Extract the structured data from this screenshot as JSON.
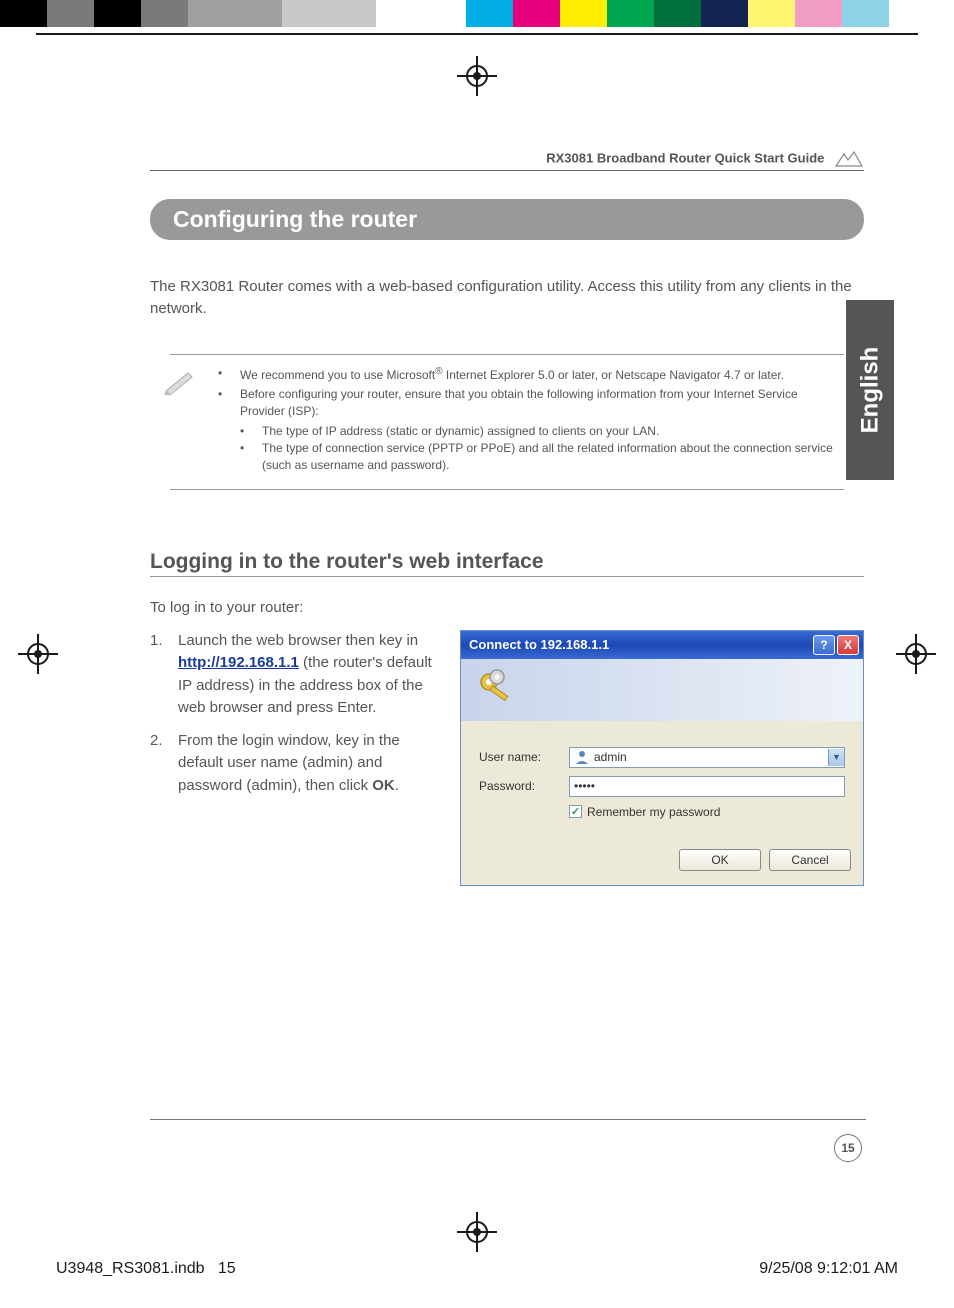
{
  "header": {
    "doc_title": "RX3081 Broadband Router Quick Start Guide"
  },
  "side_tab": {
    "label": "English"
  },
  "section": {
    "title": "Configuring the router"
  },
  "intro": "The RX3081 Router comes with a web-based configuration utility. Access this utility from any clients in the network.",
  "notes": {
    "item1_a": "We recommend you to use Microsoft",
    "item1_reg": "®",
    "item1_b": " Internet Explorer 5.0 or later, or Netscape Navigator 4.7 or later.",
    "item2": "Before configuring your router, ensure that you obtain the following information from your Internet Service Provider (ISP):",
    "sub1": "The type of IP address (static or dynamic) assigned to clients on your LAN.",
    "sub2": "The type of connection service (PPTP or PPoE) and all the related information about the connection service (such as username and password)."
  },
  "subheading": "Logging in to the router's web interface",
  "steps": {
    "intro": "To log in to your router:",
    "s1_a": "Launch the web browser then key in ",
    "s1_link": "http://192.168.1.1",
    "s1_b": " (the router's default IP address) in the address box of the web browser and press Enter.",
    "s2_a": "From the login window, key in the default user name (admin) and password (admin), then click ",
    "s2_bold": "OK",
    "s2_b": "."
  },
  "dialog": {
    "title": "Connect to 192.168.1.1",
    "user_label": "User name:",
    "user_value": "admin",
    "pass_label": "Password:",
    "pass_value": "•••••",
    "remember": "Remember my password",
    "ok": "OK",
    "cancel": "Cancel",
    "help": "?",
    "close": "X"
  },
  "page_number": "15",
  "footer": {
    "left_a": "U3948_RS3081.indb",
    "left_b": "15",
    "right": "9/25/08   9:12:01 AM"
  }
}
